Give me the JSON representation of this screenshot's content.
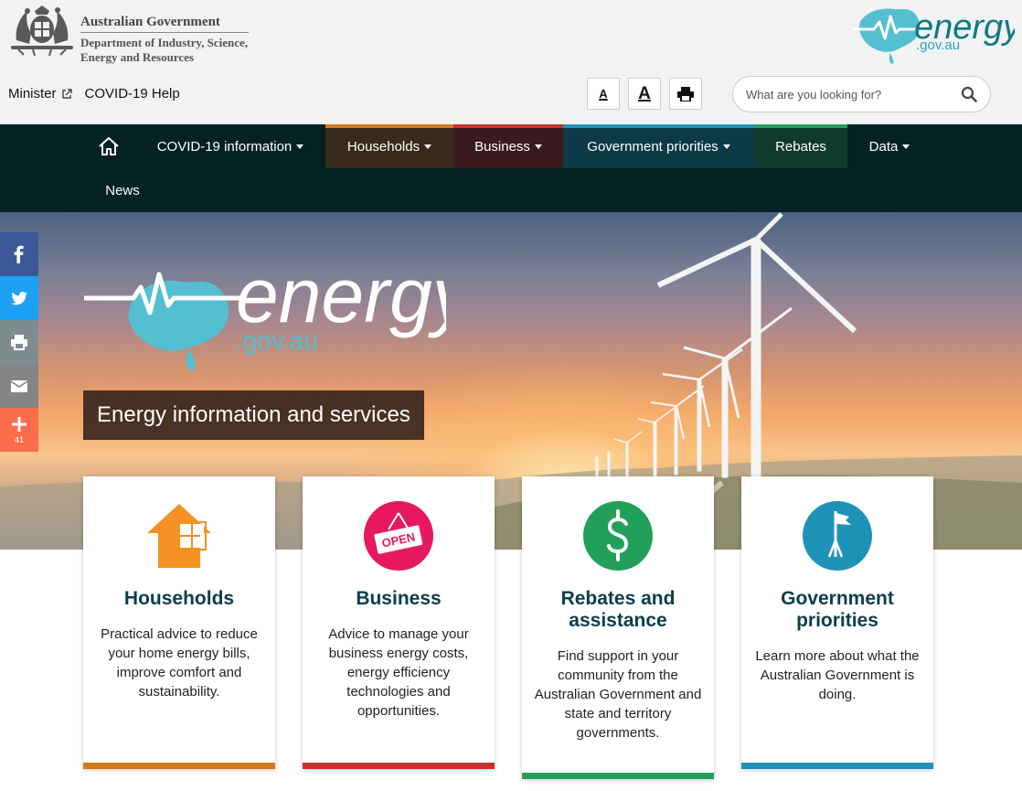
{
  "header": {
    "gov_line1": "Australian Government",
    "gov_line2": "Department of Industry, Science,",
    "gov_line3": "Energy and Resources",
    "brand_word": "energy",
    "brand_domain": ".gov.au",
    "top_links": [
      {
        "label": "Minister",
        "external": true
      },
      {
        "label": "COVID-19 Help",
        "external": false
      }
    ],
    "tools": {
      "decrease_text": "A",
      "increase_text": "A",
      "print_icon": "printer-icon"
    },
    "search": {
      "placeholder": "What are you looking for?",
      "value": ""
    }
  },
  "nav": {
    "home_icon": "home-icon",
    "items": [
      {
        "label": "COVID-19 information",
        "dropdown": true
      },
      {
        "label": "Households",
        "dropdown": true,
        "accent": "#d37a1b"
      },
      {
        "label": "Business",
        "dropdown": true,
        "accent": "#c8312c"
      },
      {
        "label": "Government priorities",
        "dropdown": true,
        "accent": "#1e93b7"
      },
      {
        "label": "Rebates",
        "dropdown": false,
        "accent": "#22a05a"
      },
      {
        "label": "Data",
        "dropdown": true
      },
      {
        "label": "News",
        "dropdown": false
      }
    ]
  },
  "hero": {
    "logo_word": "energy",
    "logo_domain": ".gov.au",
    "tagline": "Energy information and services"
  },
  "social": [
    {
      "icon": "facebook-icon",
      "color": "#3b5998"
    },
    {
      "icon": "twitter-icon",
      "color": "#1da1f2"
    },
    {
      "icon": "printer-icon",
      "color": "#7f8c8d"
    },
    {
      "icon": "email-icon",
      "color": "#848484"
    },
    {
      "icon": "plus-icon",
      "color": "#fc6d4c",
      "count": "41"
    }
  ],
  "cards": [
    {
      "title": "Households",
      "description": "Practical advice to reduce your home energy bills, improve comfort and sustainability.",
      "accent": "#d37a1b",
      "icon": "house-icon"
    },
    {
      "title": "Business",
      "description": "Advice to manage your business energy costs, energy efficiency technologies and opportunities.",
      "accent": "#c8312c",
      "icon": "open-sign-icon",
      "icon_text": "OPEN"
    },
    {
      "title": "Rebates and assistance",
      "description": "Find support in your community from the Australian Government and state and territory governments.",
      "accent": "#22a05a",
      "icon": "dollar-icon"
    },
    {
      "title": "Government priorities",
      "description": "Learn more about what the Australian Government is doing.",
      "accent": "#1e93b7",
      "icon": "flag-icon"
    }
  ]
}
